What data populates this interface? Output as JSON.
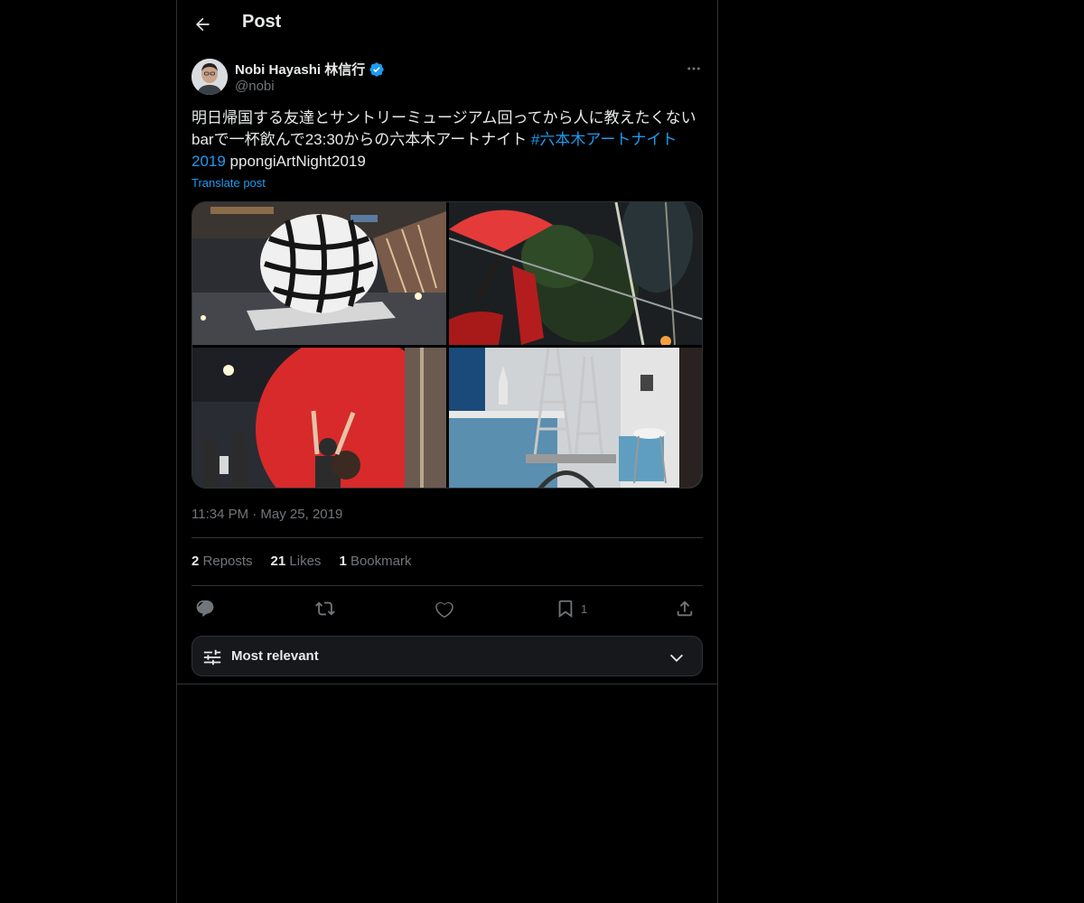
{
  "header": {
    "title": "Post"
  },
  "author": {
    "display_name": "Nobi Hayashi 林信行",
    "handle": "@nobi",
    "verified": true
  },
  "post": {
    "text_before": "明日帰国する友達とサントリーミュージアム回ってから人に教えたくないbarで一杯飲んで23:30からの六本木アートナイト ",
    "hashtag": "#六本木アートナイト2019",
    "text_after": " ppongiArtNight2019",
    "translate_label": "Translate post",
    "timestamp": "11:34 PM · May 25, 2019"
  },
  "media": [
    {
      "name": "photo-woven-sphere",
      "description_icon": "image"
    },
    {
      "name": "photo-red-umbrella-performer",
      "description_icon": "image"
    },
    {
      "name": "photo-red-ball",
      "description_icon": "image"
    },
    {
      "name": "photo-eiffel-tower-models",
      "description_icon": "image"
    }
  ],
  "stats": {
    "reposts_count": "2",
    "reposts_label": "Reposts",
    "likes_count": "21",
    "likes_label": "Likes",
    "bookmarks_count": "1",
    "bookmarks_label": "Bookmark"
  },
  "actions": {
    "reply_icon": "reply-icon",
    "repost_icon": "repost-icon",
    "like_icon": "like-icon",
    "bookmark_icon": "bookmark-icon",
    "bookmark_count": "1",
    "share_icon": "share-icon"
  },
  "sort": {
    "label": "Most relevant"
  },
  "colors": {
    "accent": "#1d9bf0",
    "background": "#000000",
    "muted": "#71767b",
    "border": "#2f3336"
  }
}
